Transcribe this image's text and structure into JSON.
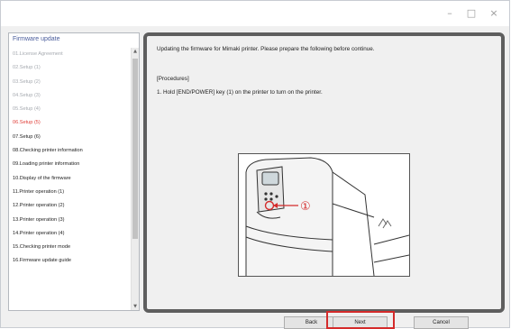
{
  "window": {
    "min_glyph": "–",
    "max_glyph": "□",
    "close_glyph": "×"
  },
  "sidebar": {
    "title": "Firmware update",
    "items": [
      {
        "label": "01.License Agreement",
        "state": "disabled"
      },
      {
        "label": "02.Setup (1)",
        "state": "disabled"
      },
      {
        "label": "03.Setup (2)",
        "state": "disabled"
      },
      {
        "label": "04.Setup (3)",
        "state": "disabled"
      },
      {
        "label": "05.Setup (4)",
        "state": "disabled"
      },
      {
        "label": "06.Setup (5)",
        "state": "current"
      },
      {
        "label": "07.Setup (6)",
        "state": "normal"
      },
      {
        "label": "08.Checking printer information",
        "state": "normal"
      },
      {
        "label": "09.Loading printer information",
        "state": "normal"
      },
      {
        "label": "10.Display of the firmware",
        "state": "normal"
      },
      {
        "label": "11.Printer operation (1)",
        "state": "normal"
      },
      {
        "label": "12.Printer operation (2)",
        "state": "normal"
      },
      {
        "label": "13.Printer operation (3)",
        "state": "normal"
      },
      {
        "label": "14.Printer operation (4)",
        "state": "normal"
      },
      {
        "label": "15.Checking printer mode",
        "state": "normal"
      },
      {
        "label": "16.Firmware update guide",
        "state": "normal"
      }
    ],
    "scroll_up_glyph": "▲",
    "scroll_down_glyph": "▼"
  },
  "content": {
    "intro": "Updating the firmware for Mimaki printer. Please prepare the following before continue.",
    "procedures_heading": "[Procedures]",
    "step_1": "1.  Hold [END/POWER] key (1) on the printer to turn on the printer.",
    "illustration_callout": "①"
  },
  "buttons": {
    "back": "Back",
    "next": "Next",
    "cancel": "Cancel"
  },
  "colors": {
    "current_step": "#e0403a",
    "highlight": "#d42b2b",
    "frame": "#5e5e5e"
  }
}
